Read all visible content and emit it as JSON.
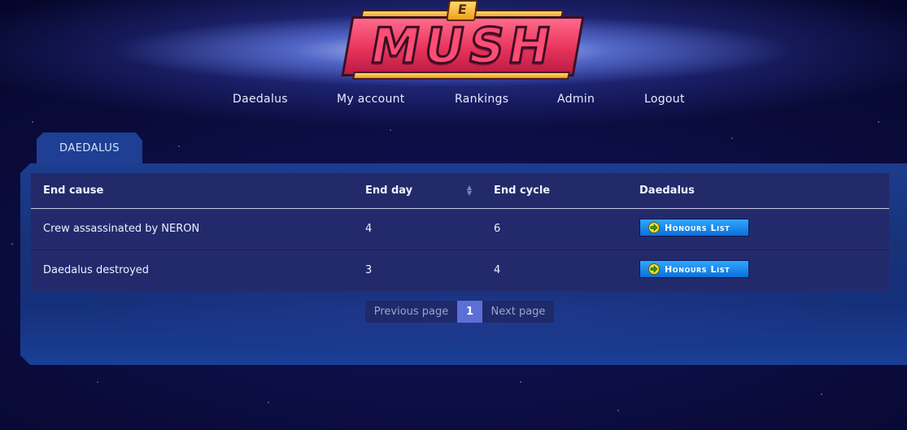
{
  "logo": {
    "badge_letter": "E",
    "wordmark": "MUSH"
  },
  "nav": [
    {
      "label": "Daedalus"
    },
    {
      "label": "My account"
    },
    {
      "label": "Rankings"
    },
    {
      "label": "Admin"
    },
    {
      "label": "Logout"
    }
  ],
  "tab": {
    "label": "DAEDALUS"
  },
  "table": {
    "headers": [
      "End cause",
      "End day",
      "End cycle",
      "Daedalus"
    ],
    "sortable_column": "End day",
    "rows": [
      {
        "end_cause": "Crew assassinated by NERON",
        "end_day": "4",
        "end_cycle": "6",
        "action": "Honours List"
      },
      {
        "end_cause": "Daedalus destroyed",
        "end_day": "3",
        "end_cycle": "4",
        "action": "Honours List"
      }
    ]
  },
  "pagination": {
    "previous_label": "Previous page",
    "current_page": "1",
    "next_label": "Next page"
  },
  "colors": {
    "accent": "#5b6fd6",
    "button": "#1e8cf0",
    "panel": "#1a3a8a"
  }
}
